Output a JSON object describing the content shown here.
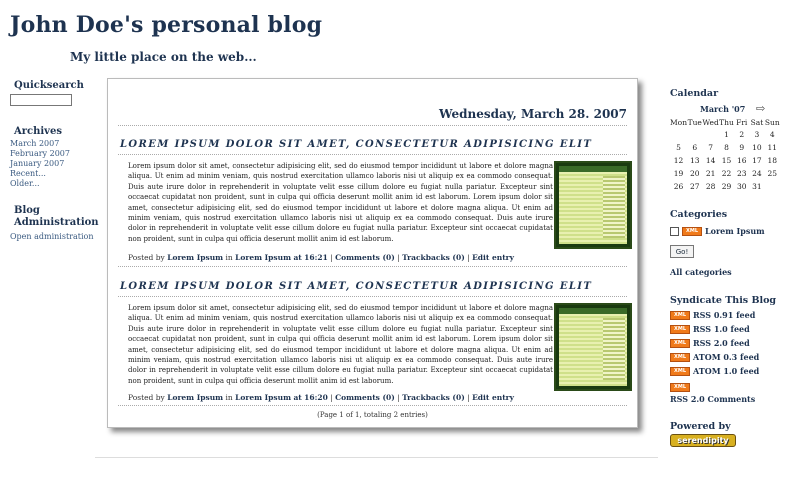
{
  "site": {
    "title": "John Doe's personal blog",
    "description": "My little place on the web..."
  },
  "left_sidebar": {
    "quicksearch_title": "Quicksearch",
    "quicksearch_value": "",
    "archives_title": "Archives",
    "archive_links": [
      "March 2007",
      "February 2007",
      "January 2007",
      "Recent...",
      "Older..."
    ],
    "admin_title": "Blog Administration",
    "admin_link": "Open administration"
  },
  "main": {
    "date_header": "Wednesday, March 28. 2007",
    "entries": [
      {
        "title": "Lorem ipsum dolor sit amet, consectetur adipisicing elit",
        "body": "Lorem ipsum dolor sit amet, consectetur adipisicing elit, sed do eiusmod tempor incididunt ut labore et dolore magna aliqua. Ut enim ad minim veniam, quis nostrud exercitation ullamco laboris nisi ut aliquip ex ea commodo consequat. Duis aute irure dolor in reprehenderit in voluptate velit esse cillum dolore eu fugiat nulla pariatur. Excepteur sint occaecat cupidatat non proident, sunt in culpa qui officia deserunt mollit anim id est laborum. Lorem ipsum dolor sit amet, consectetur adipisicing elit, sed do eiusmod tempor incididunt ut labore et dolore magna aliqua. Ut enim ad minim veniam, quis nostrud exercitation ullamco laboris nisi ut aliquip ex ea commodo consequat. Duis aute irure dolor in reprehenderit in voluptate velit esse cillum dolore eu fugiat nulla pariatur. Excepteur sint occaecat cupidatat non proident, sunt in culpa qui officia deserunt mollit anim id est laborum.",
        "posted_by_label": "Posted by",
        "author": "Lorem Ipsum",
        "in_label": "in",
        "category": "Lorem Ipsum",
        "at_label": "at",
        "time": "16:21",
        "comments": "Comments (0)",
        "trackbacks": "Trackbacks (0)",
        "edit": "Edit entry"
      },
      {
        "title": "Lorem ipsum dolor sit amet, consectetur adipisicing elit",
        "body": "Lorem ipsum dolor sit amet, consectetur adipisicing elit, sed do eiusmod tempor incididunt ut labore et dolore magna aliqua. Ut enim ad minim veniam, quis nostrud exercitation ullamco laboris nisi ut aliquip ex ea commodo consequat. Duis aute irure dolor in reprehenderit in voluptate velit esse cillum dolore eu fugiat nulla pariatur. Excepteur sint occaecat cupidatat non proident, sunt in culpa qui officia deserunt mollit anim id est laborum. Lorem ipsum dolor sit amet, consectetur adipisicing elit, sed do eiusmod tempor incididunt ut labore et dolore magna aliqua. Ut enim ad minim veniam, quis nostrud exercitation ullamco laboris nisi ut aliquip ex ea commodo consequat. Duis aute irure dolor in reprehenderit in voluptate velit esse cillum dolore eu fugiat nulla pariatur. Excepteur sint occaecat cupidatat non proident, sunt in culpa qui officia deserunt mollit anim id est laborum.",
        "posted_by_label": "Posted by",
        "author": "Lorem Ipsum",
        "in_label": "in",
        "category": "Lorem Ipsum",
        "at_label": "at",
        "time": "16:20",
        "comments": "Comments (0)",
        "trackbacks": "Trackbacks (0)",
        "edit": "Edit entry"
      }
    ],
    "page_info": "(Page 1 of 1, totaling 2 entries)"
  },
  "right_sidebar": {
    "calendar_title": "Calendar",
    "calendar_month": "March '07",
    "calendar_next_icon": "arrow-right-icon",
    "weekdays": [
      "Mon",
      "Tue",
      "Wed",
      "Thu",
      "Fri",
      "Sat",
      "Sun"
    ],
    "weeks": [
      [
        "",
        "",
        "",
        "1",
        "2",
        "3",
        "4"
      ],
      [
        "5",
        "6",
        "7",
        "8",
        "9",
        "10",
        "11"
      ],
      [
        "12",
        "13",
        "14",
        "15",
        "16",
        "17",
        "18"
      ],
      [
        "19",
        "20",
        "21",
        "22",
        "23",
        "24",
        "25"
      ],
      [
        "26",
        "27",
        "28",
        "29",
        "30",
        "31",
        ""
      ]
    ],
    "categories_title": "Categories",
    "categories": [
      {
        "badge": "XML",
        "label": "Lorem Ipsum"
      }
    ],
    "go_button": "Go!",
    "all_categories": "All categories",
    "syndicate_title": "Syndicate This Blog",
    "feeds": [
      {
        "badge": "XML",
        "label": "RSS 0.91 feed"
      },
      {
        "badge": "XML",
        "label": "RSS 1.0 feed"
      },
      {
        "badge": "XML",
        "label": "RSS 2.0 feed"
      },
      {
        "badge": "XML",
        "label": "ATOM 0.3 feed"
      },
      {
        "badge": "XML",
        "label": "ATOM 1.0 feed"
      }
    ],
    "last_feed_badge": "XML",
    "rss_comments": "RSS 2.0 Comments",
    "powered_title": "Powered by",
    "powered_logo": "serendipity"
  },
  "colors": {
    "heading": "#1e3350",
    "link": "#3a5a80",
    "xml_badge": "#f07a1a",
    "powered_badge": "#d8b020"
  }
}
